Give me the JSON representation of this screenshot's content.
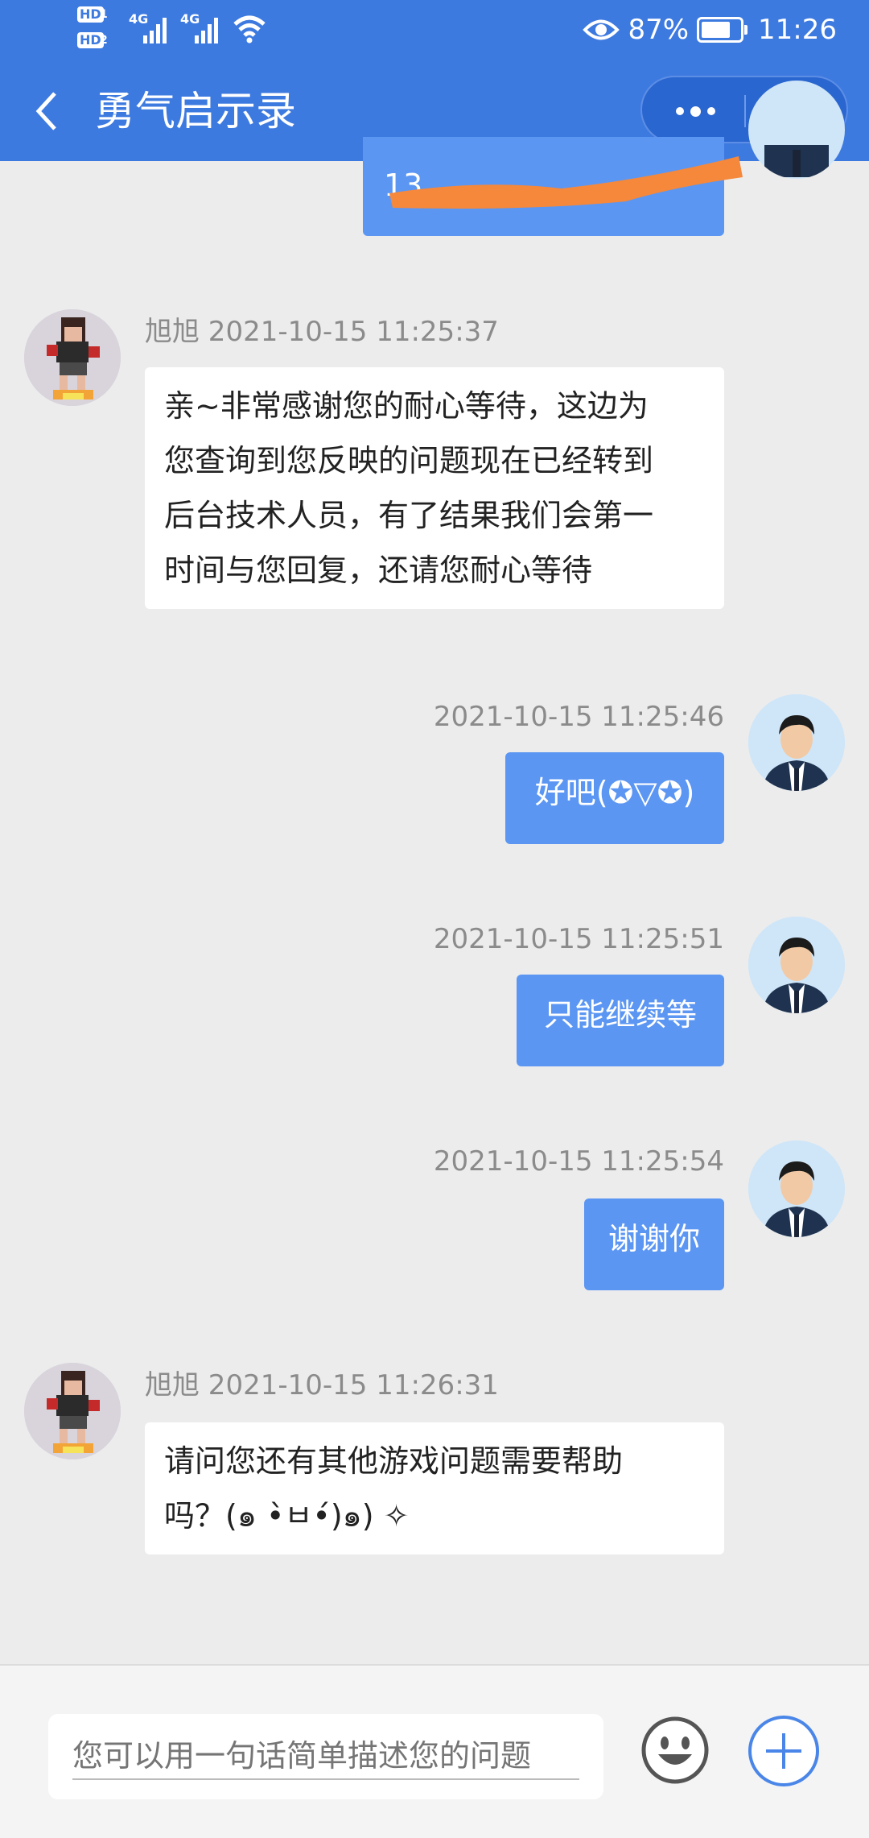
{
  "status_bar": {
    "battery_percent": "87%",
    "battery_level": 0.87,
    "time": "11:26",
    "sim1_label": "HD",
    "sim2_label": "HD",
    "network_label": "4G"
  },
  "header": {
    "title": "勇气启示录"
  },
  "colors": {
    "header_bg": "#3d7ae0",
    "my_bubble": "#5b96f3",
    "their_bubble": "#ffffff",
    "page_bg": "#ececec"
  },
  "messages": [
    {
      "sender": "旭旭",
      "timestamp": "旭旭 2021-10-15 11:25:37",
      "side": "left",
      "lines": [
        "亲~非常感谢您的耐心等待，这边为",
        "您查询到您反映的问题现在已经转到",
        "后台技术人员，有了结果我们会第一",
        "时间与您回复，还请您耐心等待"
      ]
    },
    {
      "timestamp": "2021-10-15 11:25:46",
      "side": "right",
      "text": "好吧(✪▽✪)"
    },
    {
      "timestamp": "2021-10-15 11:25:51",
      "side": "right",
      "text": "只能继续等"
    },
    {
      "timestamp": "2021-10-15 11:25:54",
      "side": "right",
      "text": "谢谢你"
    },
    {
      "sender": "旭旭",
      "timestamp": "旭旭 2021-10-15 11:26:31",
      "side": "left",
      "lines": [
        "请问您还有其他游戏问题需要帮助",
        "吗？(๑ •̀ㅂ•́)๑) ✧"
      ]
    }
  ],
  "partial_message_text": "13",
  "input": {
    "placeholder": "您可以用一句话简单描述您的问题"
  },
  "icons": {
    "back": "chevron-left-icon",
    "more": "more-dots-icon",
    "close": "target-close-icon",
    "emoji": "smiley-icon",
    "plus": "plus-circle-icon"
  }
}
